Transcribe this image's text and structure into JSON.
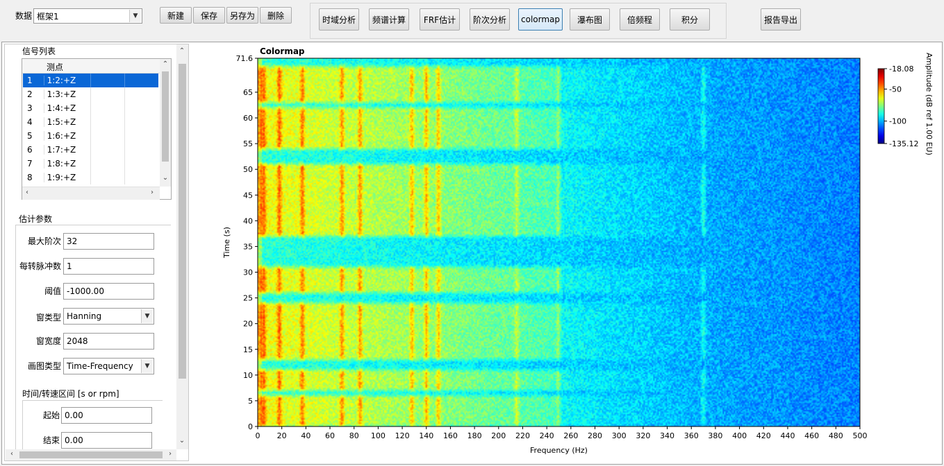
{
  "toolbar": {
    "data_label": "数据",
    "data_select_value": "框架1",
    "buttons": [
      "新建",
      "保存",
      "另存为",
      "删除"
    ],
    "analysis_tabs": [
      "时域分析",
      "频谱计算",
      "FRF估计",
      "阶次分析",
      "colormap",
      "瀑布图",
      "倍频程",
      "积分"
    ],
    "active_tab": "colormap",
    "report_button": "报告导出"
  },
  "signal_list": {
    "title": "信号列表",
    "column_header": "测点",
    "rows": [
      {
        "index": "1",
        "point": "1:2:+Z"
      },
      {
        "index": "2",
        "point": "1:3:+Z"
      },
      {
        "index": "3",
        "point": "1:4:+Z"
      },
      {
        "index": "4",
        "point": "1:5:+Z"
      },
      {
        "index": "5",
        "point": "1:6:+Z"
      },
      {
        "index": "6",
        "point": "1:7:+Z"
      },
      {
        "index": "7",
        "point": "1:8:+Z"
      },
      {
        "index": "8",
        "point": "1:9:+Z"
      }
    ],
    "selected_index": "1"
  },
  "params": {
    "title": "估计参数",
    "max_order_label": "最大阶次",
    "max_order_value": "32",
    "pulses_label": "每转脉冲数",
    "pulses_value": "1",
    "threshold_label": "阈值",
    "threshold_value": "-1000.00",
    "window_type_label": "窗类型",
    "window_type_value": "Hanning",
    "window_width_label": "窗宽度",
    "window_width_value": "2048",
    "plot_type_label": "画图类型",
    "plot_type_value": "Time-Frequency",
    "range_label": "时间/转速区间 [s or rpm]",
    "start_label": "起始",
    "start_value": "0.00",
    "end_label": "结束",
    "end_value": "0.00"
  },
  "chart_data": {
    "type": "heatmap",
    "title": "Colormap",
    "xlabel": "Frequency (Hz)",
    "ylabel": "Time (s)",
    "xlim": [
      0,
      500
    ],
    "ylim": [
      0,
      71.6
    ],
    "x_ticks": [
      "0",
      "20",
      "40",
      "60",
      "80",
      "100",
      "120",
      "140",
      "160",
      "180",
      "200",
      "220",
      "240",
      "260",
      "280",
      "300",
      "320",
      "340",
      "360",
      "380",
      "400",
      "420",
      "440",
      "460",
      "480",
      "500"
    ],
    "y_ticks": [
      "0",
      "5",
      "10",
      "15",
      "20",
      "25",
      "30",
      "35",
      "40",
      "45",
      "50",
      "55",
      "60",
      "65",
      "71.6"
    ],
    "colorbar": {
      "label": "Amplitude (dB ref 1.00 EU)",
      "max": -18.08,
      "min": -135.12,
      "ticks": [
        "-18.08",
        "-50",
        "-100",
        "-135.12"
      ]
    },
    "high_energy_time_bands_s": [
      [
        0,
        6
      ],
      [
        7,
        11
      ],
      [
        13,
        24
      ],
      [
        26,
        31
      ],
      [
        37,
        51
      ],
      [
        54,
        62
      ],
      [
        63,
        70
      ]
    ],
    "peak_frequencies_hz": [
      5,
      18,
      37,
      70,
      85,
      128,
      140,
      150,
      215,
      250,
      370
    ],
    "grid": false
  }
}
